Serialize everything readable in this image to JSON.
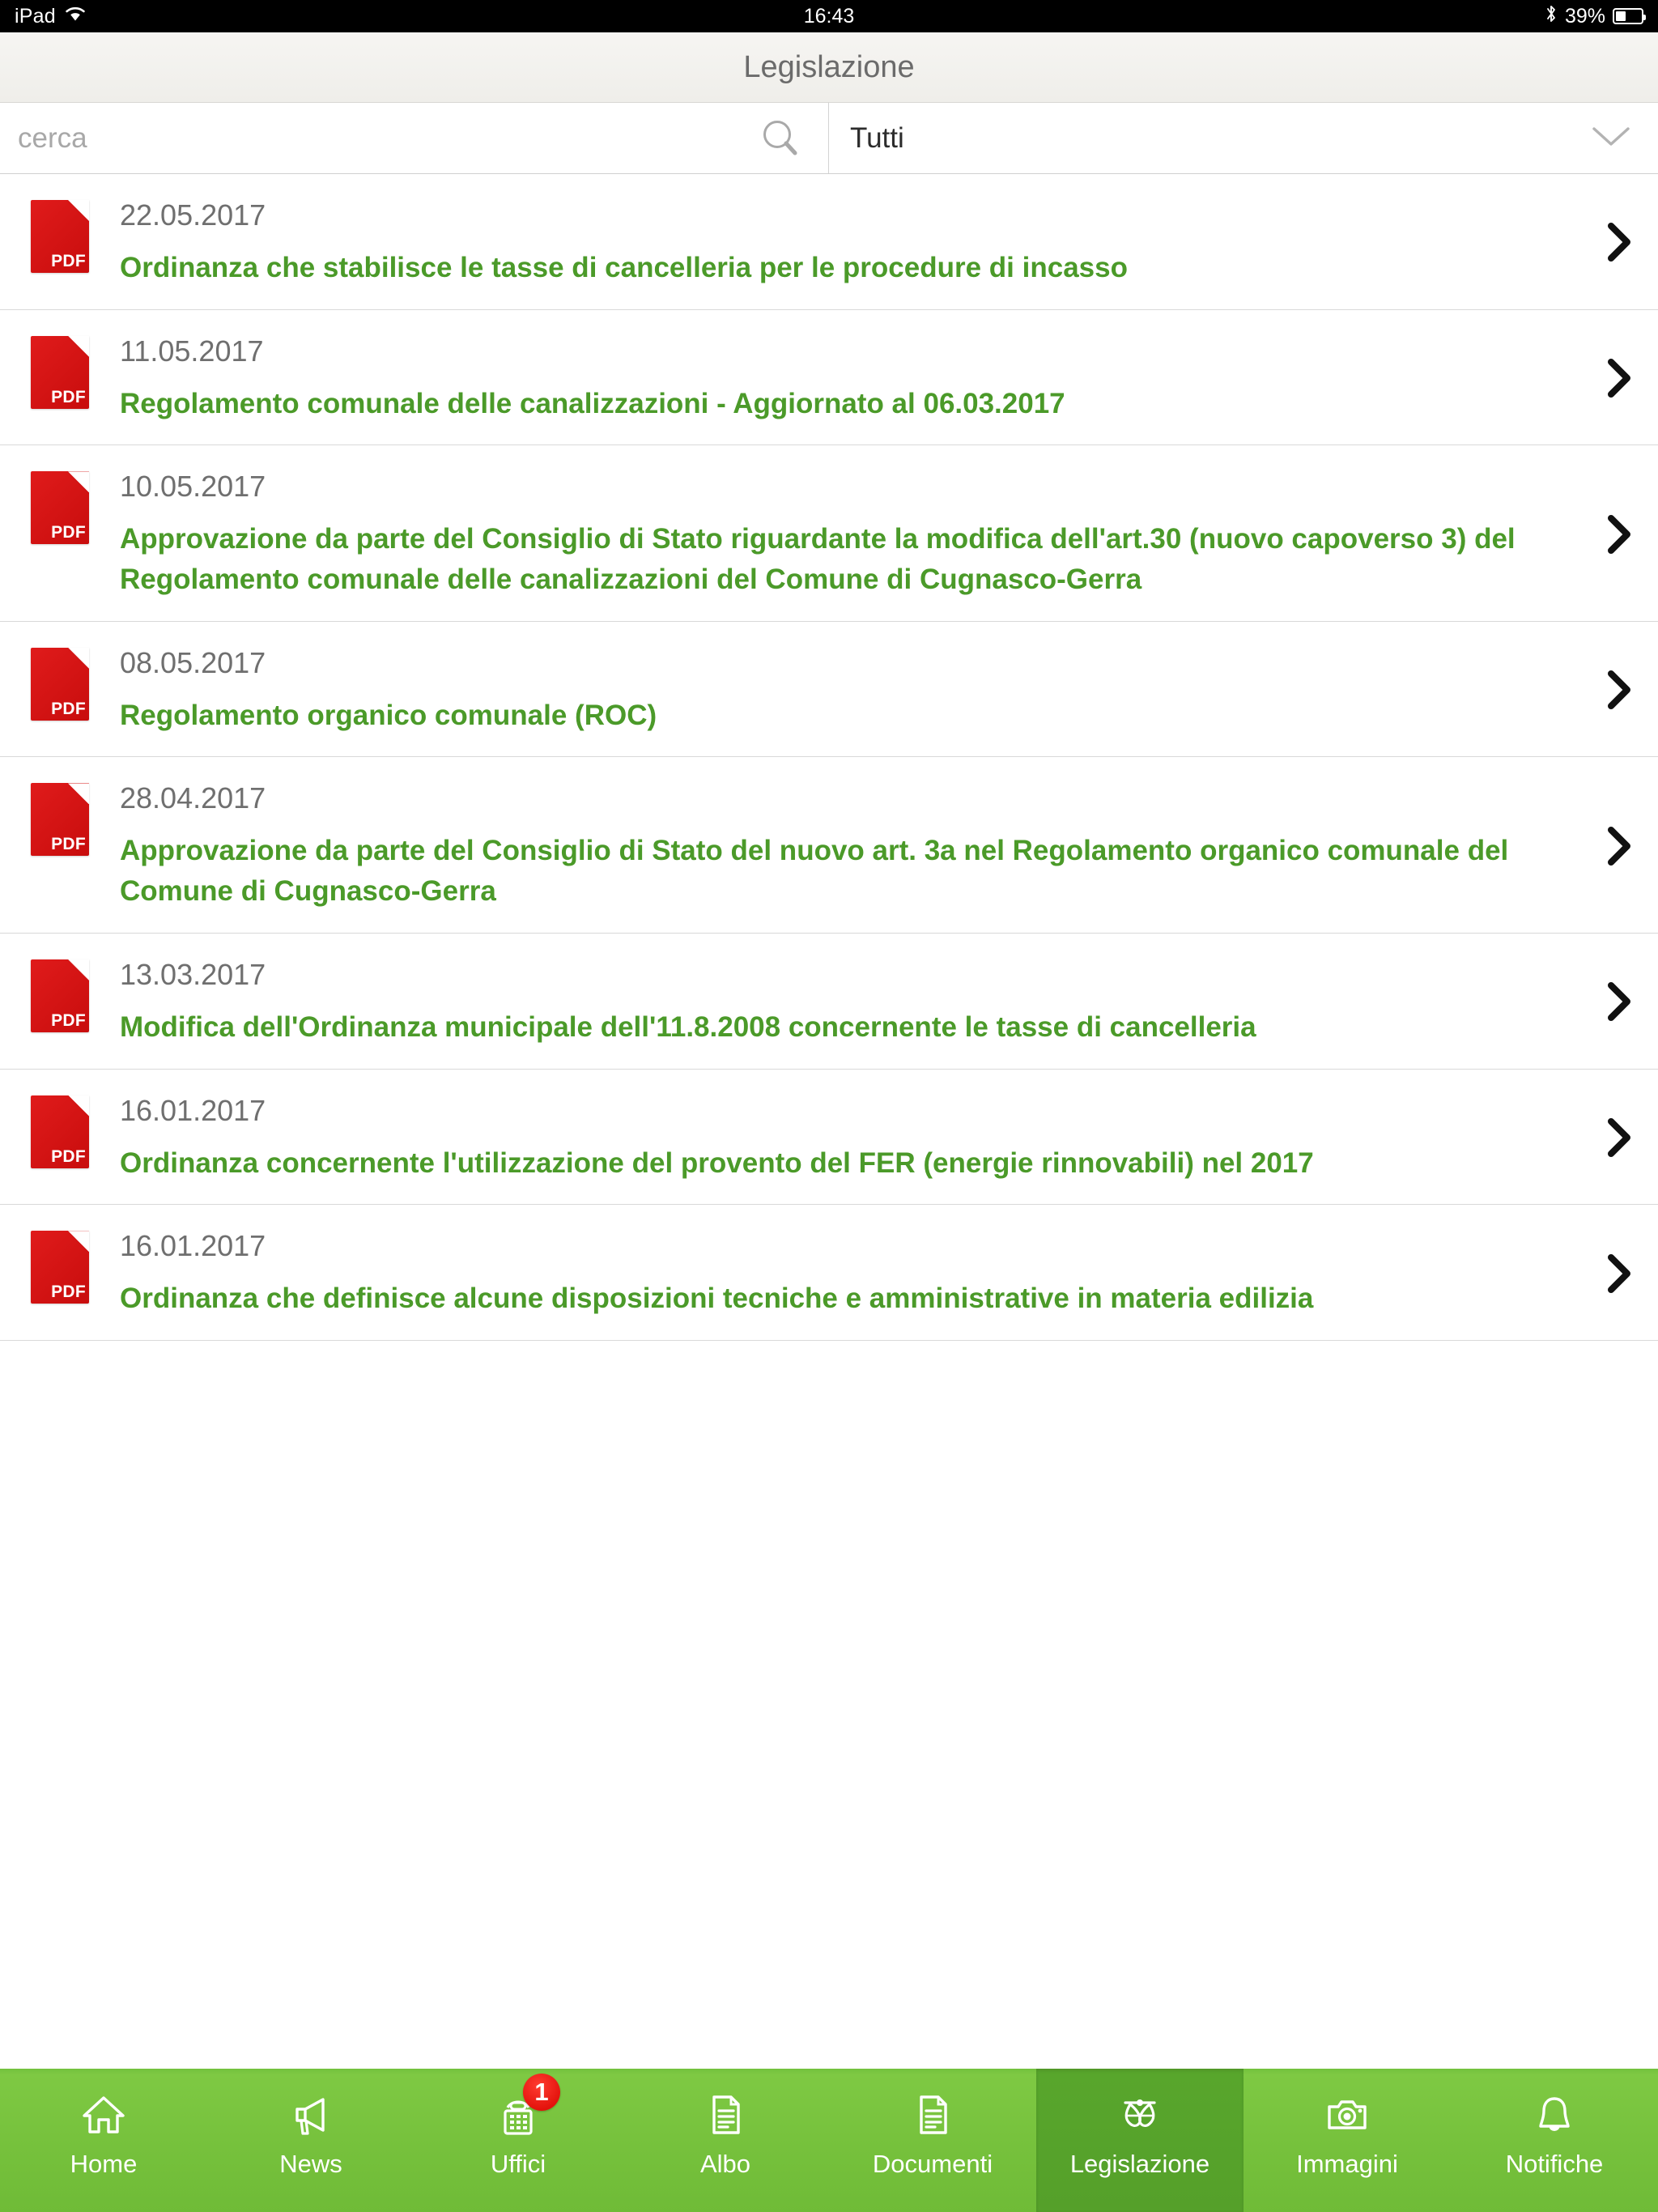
{
  "status_bar": {
    "device": "iPad",
    "wifi_icon": "wifi-icon",
    "time": "16:43",
    "bluetooth_icon": "bluetooth-icon",
    "battery_percent": "39%",
    "battery_level": 39
  },
  "header": {
    "title": "Legislazione"
  },
  "filter": {
    "search_placeholder": "cerca",
    "search_value": "",
    "search_icon": "search-icon",
    "category_selected": "Tutti",
    "category_chevron_icon": "chevron-down-icon"
  },
  "colors": {
    "brand_green": "#7ec943",
    "active_tab_green": "#58a62c",
    "title_green": "#4b9a29",
    "pdf_red": "#d01212",
    "badge_red": "#e2110b",
    "date_gray": "#6f6f6f",
    "header_bg": "#f1f0ec"
  },
  "list": {
    "row_icon": "pdf-file-icon",
    "row_arrow_icon": "chevron-right-icon",
    "pdf_label": "PDF",
    "items": [
      {
        "date": "22.05.2017",
        "title": "Ordinanza che stabilisce le tasse di cancelleria per le procedure di incasso"
      },
      {
        "date": "11.05.2017",
        "title": "Regolamento comunale delle canalizzazioni - Aggiornato al 06.03.2017"
      },
      {
        "date": "10.05.2017",
        "title": "Approvazione da parte del Consiglio di Stato riguardante la modifica dell'art.30 (nuovo capoverso 3) del Regolamento comunale delle canalizzazioni del Comune di Cugnasco-Gerra"
      },
      {
        "date": "08.05.2017",
        "title": "Regolamento organico comunale (ROC)"
      },
      {
        "date": "28.04.2017",
        "title": "Approvazione da parte del Consiglio di Stato del nuovo art. 3a nel Regolamento organico comunale del Comune di Cugnasco-Gerra"
      },
      {
        "date": "13.03.2017",
        "title": "Modifica dell'Ordinanza municipale dell'11.8.2008 concernente le tasse di cancelleria"
      },
      {
        "date": "16.01.2017",
        "title": "Ordinanza concernente l'utilizzazione del provento del FER (energie rinnovabili) nel 2017"
      },
      {
        "date": "16.01.2017",
        "title": "Ordinanza che definisce alcune disposizioni tecniche e amministrative in materia edilizia"
      }
    ]
  },
  "tab_bar": {
    "tabs": [
      {
        "label": "Home",
        "icon": "home-icon",
        "active": false,
        "badge": ""
      },
      {
        "label": "News",
        "icon": "megaphone-icon",
        "active": false,
        "badge": ""
      },
      {
        "label": "Uffici",
        "icon": "telephone-icon",
        "active": false,
        "badge": "1"
      },
      {
        "label": "Albo",
        "icon": "document-icon",
        "active": false,
        "badge": ""
      },
      {
        "label": "Documenti",
        "icon": "document-icon",
        "active": false,
        "badge": ""
      },
      {
        "label": "Legislazione",
        "icon": "scales-icon",
        "active": true,
        "badge": ""
      },
      {
        "label": "Immagini",
        "icon": "camera-icon",
        "active": false,
        "badge": ""
      },
      {
        "label": "Notifiche",
        "icon": "bell-icon",
        "active": false,
        "badge": ""
      }
    ]
  }
}
